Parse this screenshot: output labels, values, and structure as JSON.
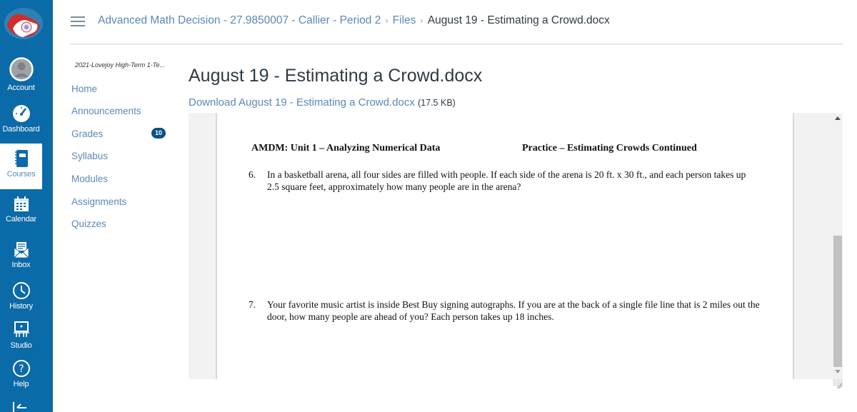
{
  "global_nav": {
    "items": [
      {
        "label": "Account",
        "icon": "account-avatar-icon"
      },
      {
        "label": "Dashboard",
        "icon": "dashboard-icon"
      },
      {
        "label": "Courses",
        "icon": "courses-icon",
        "active": true
      },
      {
        "label": "Calendar",
        "icon": "calendar-icon"
      },
      {
        "label": "Inbox",
        "icon": "inbox-icon"
      },
      {
        "label": "History",
        "icon": "history-icon"
      },
      {
        "label": "Studio",
        "icon": "studio-icon"
      },
      {
        "label": "Help",
        "icon": "help-icon"
      }
    ],
    "collapse_icon": "collapse-nav-icon",
    "brand_color": "#0b6aa8"
  },
  "header": {
    "breadcrumb": [
      {
        "label": "Advanced Math Decision - 27.9850007 - Callier - Period 2"
      },
      {
        "label": "Files"
      },
      {
        "label": "August 19 - Estimating a Crowd.docx",
        "current": true
      }
    ],
    "separator": "›"
  },
  "course_nav": {
    "term": "2021-Lovejoy High-Term 1-Te...",
    "items": [
      {
        "label": "Home"
      },
      {
        "label": "Announcements"
      },
      {
        "label": "Grades",
        "badge": "10"
      },
      {
        "label": "Syllabus"
      },
      {
        "label": "Modules"
      },
      {
        "label": "Assignments"
      },
      {
        "label": "Quizzes"
      }
    ]
  },
  "file": {
    "title": "August 19 - Estimating a Crowd.docx",
    "download_label": "Download August 19 - Estimating a Crowd.docx",
    "size": "(17.5 KB)"
  },
  "document": {
    "header_left": "AMDM: Unit 1 – Analyzing Numerical Data",
    "header_right": "Practice – Estimating Crowds Continued",
    "questions": [
      {
        "number": "6.",
        "text": "In a basketball arena, all four sides are filled with people. If each side of the arena is 20 ft. x 30 ft., and each person takes up 2.5 square feet, approximately how many people are in the arena?"
      },
      {
        "number": "7.",
        "text": "Your favorite music artist is inside Best Buy signing autographs. If you are at the back of a single file line that is 2 miles out the door, how many people are ahead of you? Each person takes up 18 inches."
      }
    ]
  }
}
